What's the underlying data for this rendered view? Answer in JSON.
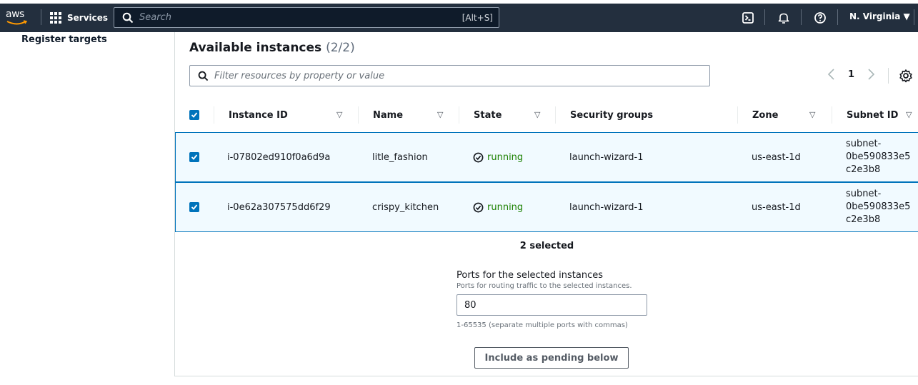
{
  "nav": {
    "logo_text": "aws",
    "services_label": "Services",
    "search_placeholder": "Search",
    "search_shortcut": "[Alt+S]",
    "region_label": "N. Virginia ▼",
    "colors": {
      "bg": "#232f3e",
      "accent": "#ff9900"
    }
  },
  "sidebar": {
    "register_targets_label": "Register targets"
  },
  "panel": {
    "title": "Available instances",
    "title_count": "(2/2)",
    "filter_placeholder": "Filter resources by property or value",
    "page_number": "1",
    "prev_glyph": "〈",
    "next_glyph": "〉"
  },
  "table": {
    "columns": [
      "Instance ID",
      "Name",
      "State",
      "Security groups",
      "Zone",
      "Subnet ID"
    ],
    "rows": [
      {
        "instance_id": "i-07802ed910f0a6d9a",
        "name": "litle_fashion",
        "state": "running",
        "security_group": "launch-wizard-1",
        "zone": "us-east-1d",
        "subnet": [
          "subnet-",
          "0be590833e5",
          "c2e3b8"
        ]
      },
      {
        "instance_id": "i-0e62a307575dd6f29",
        "name": "crispy_kitchen",
        "state": "running",
        "security_group": "launch-wizard-1",
        "zone": "us-east-1d",
        "subnet": [
          "subnet-",
          "0be590833e5",
          "c2e3b8"
        ]
      }
    ],
    "colors": {
      "selected_row_bg": "#f1faff",
      "selected_border": "#0073bb",
      "running": "#1d8102"
    }
  },
  "selection": {
    "summary": "2 selected",
    "ports_label": "Ports for the selected instances",
    "ports_description": "Ports for routing traffic to the selected instances.",
    "ports_value": "80",
    "ports_hint": "1-65535 (separate multiple ports with commas)",
    "include_button": "Include as pending below"
  }
}
